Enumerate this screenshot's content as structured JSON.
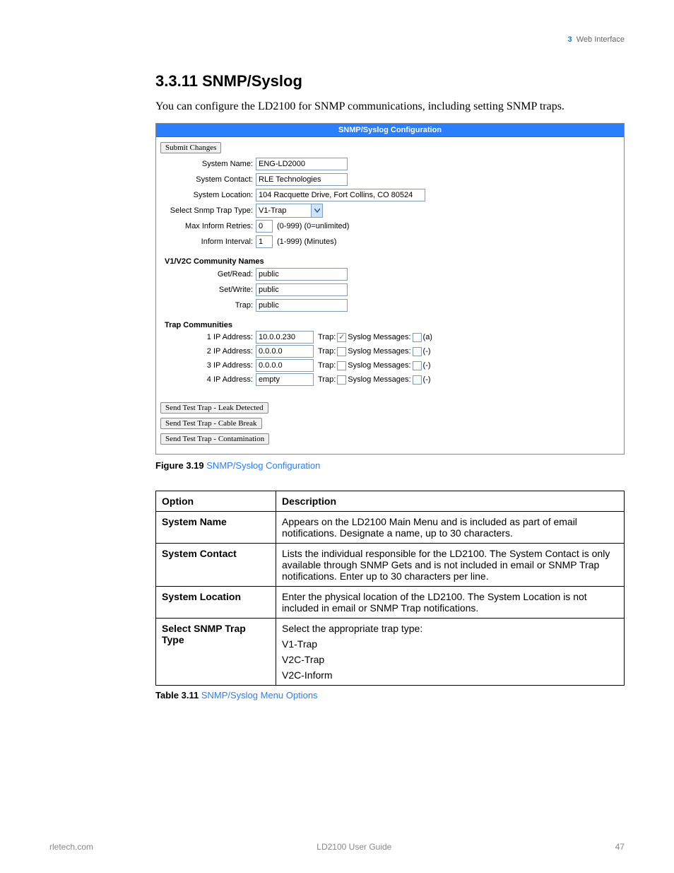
{
  "header": {
    "chapter_num": "3",
    "chapter_title": "Web Interface"
  },
  "section": {
    "number": "3.3.11",
    "title": "SNMP/Syslog"
  },
  "intro": "You can configure the LD2100 for SNMP communications, including setting SNMP traps.",
  "config": {
    "banner": "SNMP/Syslog Configuration",
    "submit_label": "Submit Changes",
    "fields": {
      "system_name_label": "System Name:",
      "system_name_value": "ENG-LD2000",
      "system_contact_label": "System Contact:",
      "system_contact_value": "RLE Technologies",
      "system_location_label": "System Location:",
      "system_location_value": "104 Racquette Drive, Fort Collins, CO 80524",
      "trap_type_label": "Select Snmp Trap Type:",
      "trap_type_value": "V1-Trap",
      "max_retries_label": "Max Inform Retries:",
      "max_retries_value": "0",
      "max_retries_hint": "(0-999) (0=unlimited)",
      "inform_interval_label": "Inform Interval:",
      "inform_interval_value": "1",
      "inform_interval_hint": "(1-999) (Minutes)"
    },
    "communities_header": "V1/V2C Community Names",
    "communities": {
      "get_label": "Get/Read:",
      "get_value": "public",
      "set_label": "Set/Write:",
      "set_value": "public",
      "trap_label": "Trap:",
      "trap_value": "public"
    },
    "trap_section_header": "Trap Communities",
    "trap_label_word": "Trap:",
    "syslog_label_word": "Syslog Messages:",
    "traps": [
      {
        "label": "1 IP Address:",
        "ip": "10.0.0.230",
        "trap_checked": true,
        "syslog_checked": false,
        "suffix": "(a)"
      },
      {
        "label": "2 IP Address:",
        "ip": "0.0.0.0",
        "trap_checked": false,
        "syslog_checked": false,
        "suffix": "(-)"
      },
      {
        "label": "3 IP Address:",
        "ip": "0.0.0.0",
        "trap_checked": false,
        "syslog_checked": false,
        "suffix": "(-)"
      },
      {
        "label": "4 IP Address:",
        "ip": "empty",
        "trap_checked": false,
        "syslog_checked": false,
        "suffix": "(-)"
      }
    ],
    "test_buttons": {
      "leak": "Send Test Trap - Leak Detected",
      "cable": "Send Test Trap - Cable Break",
      "contam": "Send Test Trap - Contamination"
    }
  },
  "figure": {
    "num": "Figure 3.19",
    "title": "SNMP/Syslog Configuration"
  },
  "options_table": {
    "head_option": "Option",
    "head_desc": "Description",
    "rows": [
      {
        "opt": "System Name",
        "desc": "Appears on the LD2100 Main Menu and is included as part of email notifications. Designate a name, up to 30 characters."
      },
      {
        "opt": "System Contact",
        "desc": "Lists the individual responsible for the LD2100. The System Contact is only available through SNMP Gets and is not included in email or SNMP Trap notifications. Enter up to 30 characters per line."
      },
      {
        "opt": "System Location",
        "desc": "Enter the physical location of the LD2100. The System Location is not included in email or SNMP Trap notifications."
      }
    ],
    "trap_row": {
      "opt": "Select SNMP Trap Type",
      "desc_intro": "Select the appropriate trap type:",
      "options": [
        "V1-Trap",
        "V2C-Trap",
        "V2C-Inform"
      ]
    }
  },
  "table_caption": {
    "num": "Table 3.11",
    "title": "SNMP/Syslog Menu Options"
  },
  "footer": {
    "left": "rletech.com",
    "center": "LD2100 User Guide",
    "right": "47"
  }
}
